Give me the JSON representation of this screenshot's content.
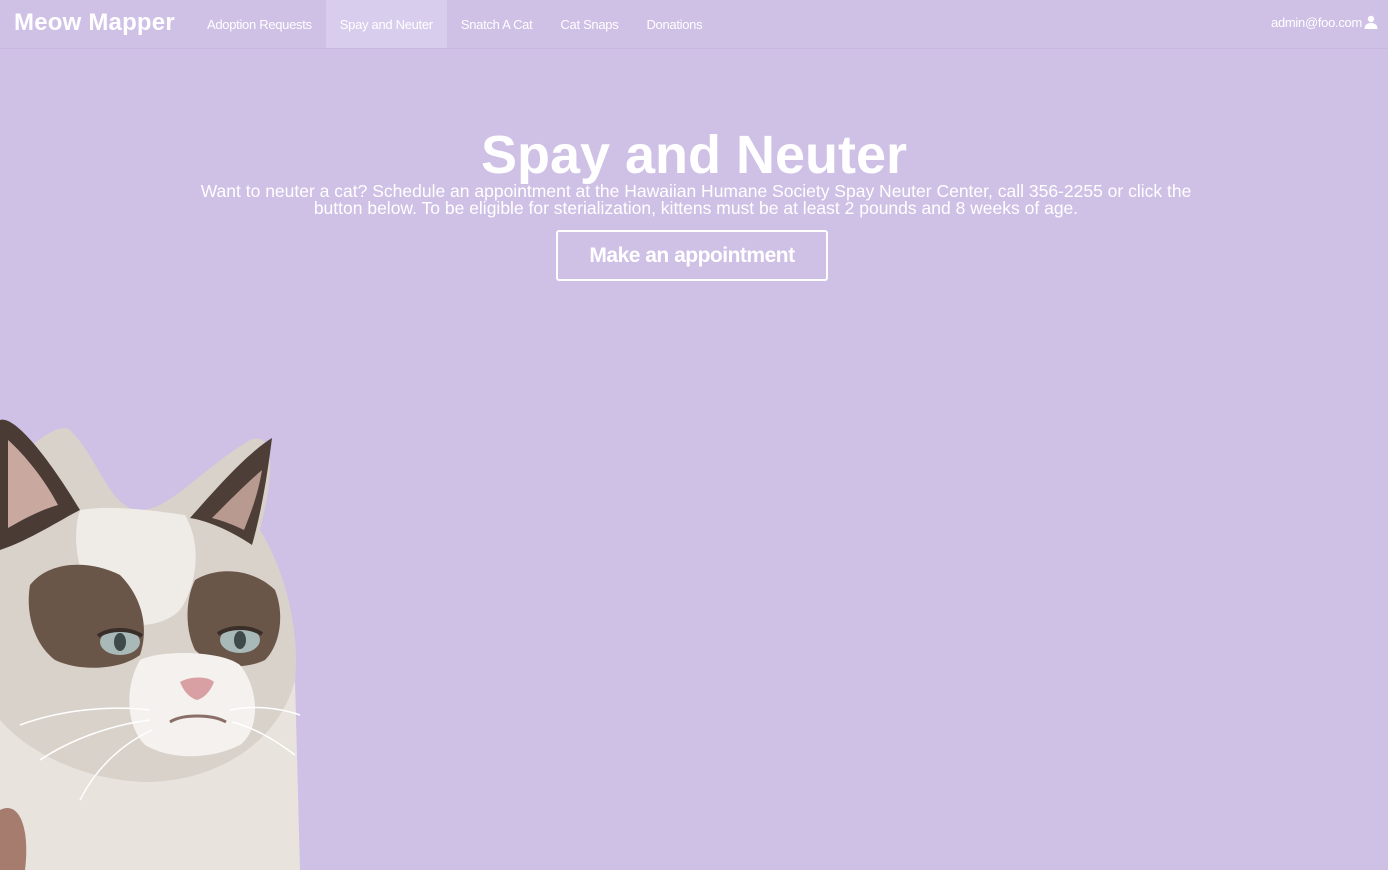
{
  "brand": "Meow Mapper",
  "nav": {
    "items": [
      {
        "label": "Adoption Requests",
        "active": false
      },
      {
        "label": "Spay and Neuter",
        "active": true
      },
      {
        "label": "Snatch A Cat",
        "active": false
      },
      {
        "label": "Cat Snaps",
        "active": false
      },
      {
        "label": "Donations",
        "active": false
      }
    ],
    "user": "admin@foo.com",
    "user_icon": "user-icon"
  },
  "hero": {
    "title": "Spay and Neuter",
    "description": "Want to neuter a cat? Schedule an appointment at the Hawaiian Humane Society Spay Neuter Center, call 356-2255 or click the button below. To be eligible for sterialization, kittens must be at least 2 pounds and 8 weeks of age.",
    "button_label": "Make an appointment"
  },
  "colors": {
    "background": "#cfc0e6",
    "active_nav": "#d9cdee",
    "text": "#ffffff"
  }
}
